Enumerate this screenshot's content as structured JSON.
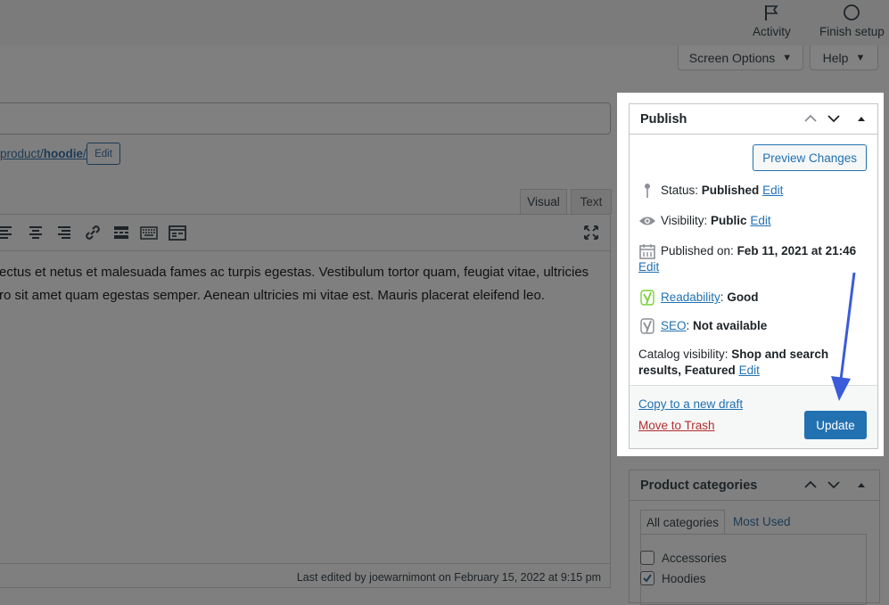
{
  "topbar": {
    "activity_label": "Activity",
    "finish_setup_label": "Finish setup"
  },
  "screen_options": {
    "label": "Screen Options",
    "arrow": "▼"
  },
  "help": {
    "label": "Help",
    "arrow": "▼"
  },
  "permalink": {
    "prefix": "product/",
    "slug": "hoodie",
    "suffix": "/",
    "edit_label": "Edit"
  },
  "editor": {
    "tabs": {
      "visual": "Visual",
      "text": "Text"
    },
    "toolbar_icons": [
      "align-left-icon",
      "align-center-icon",
      "align-right-icon",
      "link-icon",
      "more-tag-icon",
      "keyboard-icon",
      "toolbar-toggle-icon",
      "fullscreen-icon"
    ],
    "content_line1": "ectus et netus et malesuada fames ac turpis egestas. Vestibulum tortor quam, feugiat vitae, ultricies",
    "content_line2": "ro sit amet quam egestas semper. Aenean ultricies mi vitae est. Mauris placerat eleifend leo.",
    "last_edited": "Last edited by joewarnimont on February 15, 2022 at 9:15 pm"
  },
  "publish": {
    "title": "Publish",
    "preview_label": "Preview Changes",
    "status_label": "Status: ",
    "status_value": "Published",
    "status_edit": "Edit",
    "visibility_label": "Visibility: ",
    "visibility_value": "Public",
    "visibility_edit": "Edit",
    "published_label": "Published on: ",
    "published_value": "Feb 11, 2021 at 21:46",
    "published_edit": "Edit",
    "readability_link": "Readability",
    "readability_value": "Good",
    "seo_link": "SEO",
    "seo_value": "Not available",
    "catalog_label": "Catalog visibility: ",
    "catalog_value_1": "Shop and search",
    "catalog_value_2": "results, Featured",
    "catalog_edit": "Edit",
    "copy_draft": "Copy to a new draft",
    "move_trash": "Move to Trash",
    "update_label": "Update",
    "colors": {
      "primary": "#2271b1",
      "trash": "#b32d2e",
      "readability_good": "#7ad03a",
      "arrow": "#3b5bdb"
    }
  },
  "categories": {
    "title": "Product categories",
    "tab_all": "All categories",
    "tab_used": "Most Used",
    "items": [
      {
        "label": "Accessories",
        "checked": false
      },
      {
        "label": "Hoodies",
        "checked": true
      }
    ]
  }
}
